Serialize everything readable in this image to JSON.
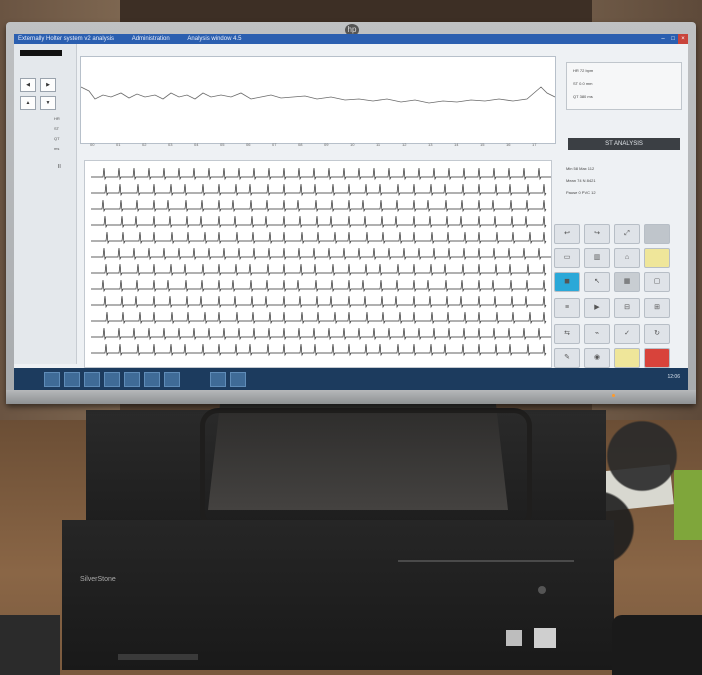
{
  "window": {
    "title_segments": [
      "Externally Holter system v2 analysis",
      "Administration",
      "Analysis window 4.5"
    ],
    "controls": {
      "minimize": "–",
      "maximize": "□",
      "close": "×"
    }
  },
  "left_panel": {
    "buttons": [
      "◀",
      "▶",
      "▲",
      "▼"
    ],
    "labels": [
      "HR",
      "ST",
      "QT",
      "ms"
    ]
  },
  "trend": {
    "axis_ticks": [
      "00",
      "01",
      "02",
      "03",
      "04",
      "05",
      "06",
      "07",
      "08",
      "09",
      "10",
      "11",
      "12",
      "13",
      "14",
      "15",
      "16",
      "17"
    ]
  },
  "ecg": {
    "lead_label": "II"
  },
  "info_box": {
    "rows": [
      "HR  72 bpm",
      "ST  0.0 mm",
      "QT  380 ms"
    ]
  },
  "status_button": {
    "label": "ST ANALYSIS"
  },
  "stats": {
    "rows": [
      "Min  58   Max  112",
      "Mean  74   N  8421",
      "Pause  0   PVC  12"
    ]
  },
  "taskbar": {
    "clock": "12:06"
  },
  "pc": {
    "brand": "SilverStone"
  },
  "colors": {
    "titlebar": "#2b5fb0",
    "taskbar": "#1c3b5e",
    "active_button": "#2aa8d8",
    "alert_button": "#d8433b"
  }
}
